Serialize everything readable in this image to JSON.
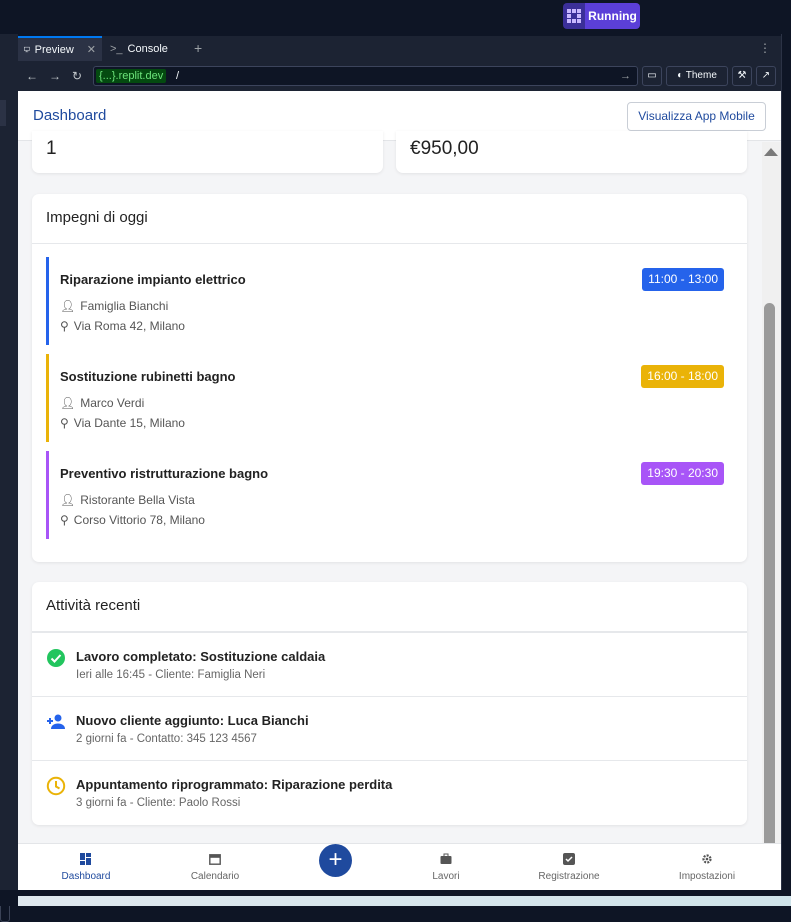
{
  "topbar": {
    "run_label": "Running"
  },
  "tabs": [
    {
      "label": "Preview"
    },
    {
      "label": "Console"
    }
  ],
  "urlbar": {
    "host": "{...}.replit.dev",
    "path": "/",
    "theme_label": "Theme"
  },
  "header": {
    "title": "Dashboard",
    "mobile_button": "Visualizza App Mobile"
  },
  "stats": [
    {
      "value": "1"
    },
    {
      "value": "€950,00"
    }
  ],
  "today": {
    "title": "Impegni di oggi",
    "items": [
      {
        "title": "Riparazione impianto elettrico",
        "client": "Famiglia Bianchi",
        "address": "Via Roma 42, Milano",
        "time": "11:00 - 13:00",
        "color": "#2563eb"
      },
      {
        "title": "Sostituzione rubinetti bagno",
        "client": "Marco Verdi",
        "address": "Via Dante 15, Milano",
        "time": "16:00 - 18:00",
        "color": "#eab308"
      },
      {
        "title": "Preventivo ristrutturazione bagno",
        "client": "Ristorante Bella Vista",
        "address": "Corso Vittorio 78, Milano",
        "time": "19:30 - 20:30",
        "color": "#a855f7"
      }
    ]
  },
  "recent": {
    "title": "Attività recenti",
    "items": [
      {
        "icon": "check-circle-icon",
        "title": "Lavoro completato: Sostituzione caldaia",
        "detail": "Ieri alle 16:45 - Cliente: Famiglia Neri",
        "color": "#22c55e"
      },
      {
        "icon": "add-person-icon",
        "title": "Nuovo cliente aggiunto: Luca Bianchi",
        "detail": "2 giorni fa - Contatto: 345 123 4567",
        "color": "#2563eb"
      },
      {
        "icon": "clock-icon",
        "title": "Appuntamento riprogrammato: Riparazione perdita",
        "detail": "3 giorni fa - Cliente: Paolo Rossi",
        "color": "#eab308"
      }
    ]
  },
  "bottom_nav": [
    {
      "label": "Dashboard",
      "icon": "dashboard-icon"
    },
    {
      "label": "Calendario",
      "icon": "calendar-icon"
    },
    {
      "label": "Lavori",
      "icon": "briefcase-icon"
    },
    {
      "label": "Registrazione",
      "icon": "checkbox-icon"
    },
    {
      "label": "Impostazioni",
      "icon": "gear-icon"
    }
  ],
  "fab_label": "+",
  "colors": {
    "accent": "#1f4a9e",
    "run": "#5b3fd8"
  }
}
